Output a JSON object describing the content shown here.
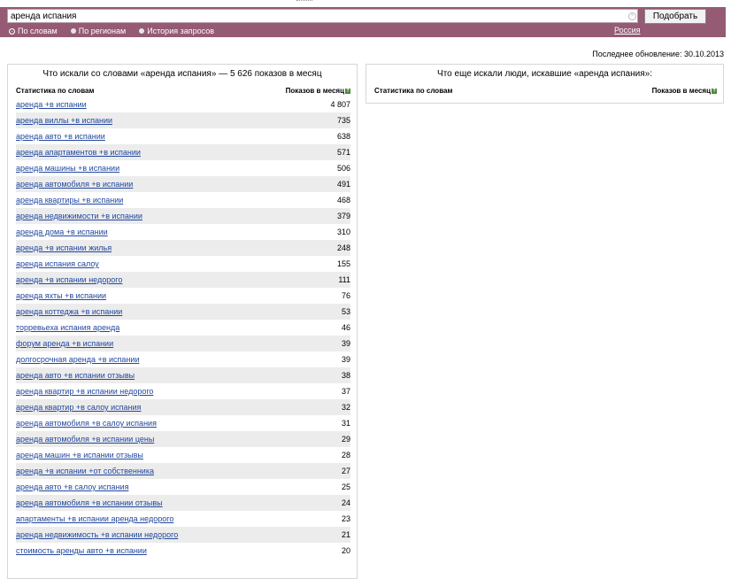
{
  "search": {
    "query": "аренда испания",
    "submit_label": "Подобрать",
    "modes": [
      "По словам",
      "По регионам",
      "История запросов"
    ],
    "region": "Россия"
  },
  "updated": "Последнее обновление: 30.10.2013",
  "left_panel": {
    "title": "Что искали со словами «аренда испания» — 5 626 показов в месяц",
    "col_stats": "Статистика по словам",
    "col_shows": "Показов в месяц",
    "rows": [
      {
        "phrase": "аренда +в испании",
        "count": "4 807"
      },
      {
        "phrase": "аренда виллы +в испании",
        "count": "735"
      },
      {
        "phrase": "аренда авто +в испании",
        "count": "638"
      },
      {
        "phrase": "аренда апартаментов +в испании",
        "count": "571"
      },
      {
        "phrase": "аренда машины +в испании",
        "count": "506"
      },
      {
        "phrase": "аренда автомобиля +в испании",
        "count": "491"
      },
      {
        "phrase": "аренда квартиры +в испании",
        "count": "468"
      },
      {
        "phrase": "аренда недвижимости +в испании",
        "count": "379"
      },
      {
        "phrase": "аренда дома +в испании",
        "count": "310"
      },
      {
        "phrase": "аренда +в испании жилья",
        "count": "248"
      },
      {
        "phrase": "аренда испания салоу",
        "count": "155"
      },
      {
        "phrase": "аренда +в испании недорого",
        "count": "111"
      },
      {
        "phrase": "аренда яхты +в испании",
        "count": "76"
      },
      {
        "phrase": "аренда коттеджа +в испании",
        "count": "53"
      },
      {
        "phrase": "торревьеха испания аренда",
        "count": "46"
      },
      {
        "phrase": "форум аренда +в испании",
        "count": "39"
      },
      {
        "phrase": "долгосрочная аренда +в испании",
        "count": "39"
      },
      {
        "phrase": "аренда авто +в испании отзывы",
        "count": "38"
      },
      {
        "phrase": "аренда квартир +в испании недорого",
        "count": "37"
      },
      {
        "phrase": "аренда квартир +в салоу испания",
        "count": "32"
      },
      {
        "phrase": "аренда автомобиля +в салоу испания",
        "count": "31"
      },
      {
        "phrase": "аренда автомобиля +в испании цены",
        "count": "29"
      },
      {
        "phrase": "аренда машин +в испании отзывы",
        "count": "28"
      },
      {
        "phrase": "аренда +в испании +от собственника",
        "count": "27"
      },
      {
        "phrase": "аренда авто +в салоу испания",
        "count": "25"
      },
      {
        "phrase": "аренда автомобиля +в испании отзывы",
        "count": "24"
      },
      {
        "phrase": "апартаменты +в испании аренда недорого",
        "count": "23"
      },
      {
        "phrase": "аренда недвижимость +в испании недорого",
        "count": "21"
      },
      {
        "phrase": "стоимость аренды авто +в испании",
        "count": "20"
      }
    ]
  },
  "right_panel": {
    "title": "Что еще искали люди, искавшие «аренда испания»:",
    "col_stats": "Статистика по словам",
    "col_shows": "Показов в месяц"
  },
  "icons": {
    "help": "?",
    "clear": "×"
  }
}
